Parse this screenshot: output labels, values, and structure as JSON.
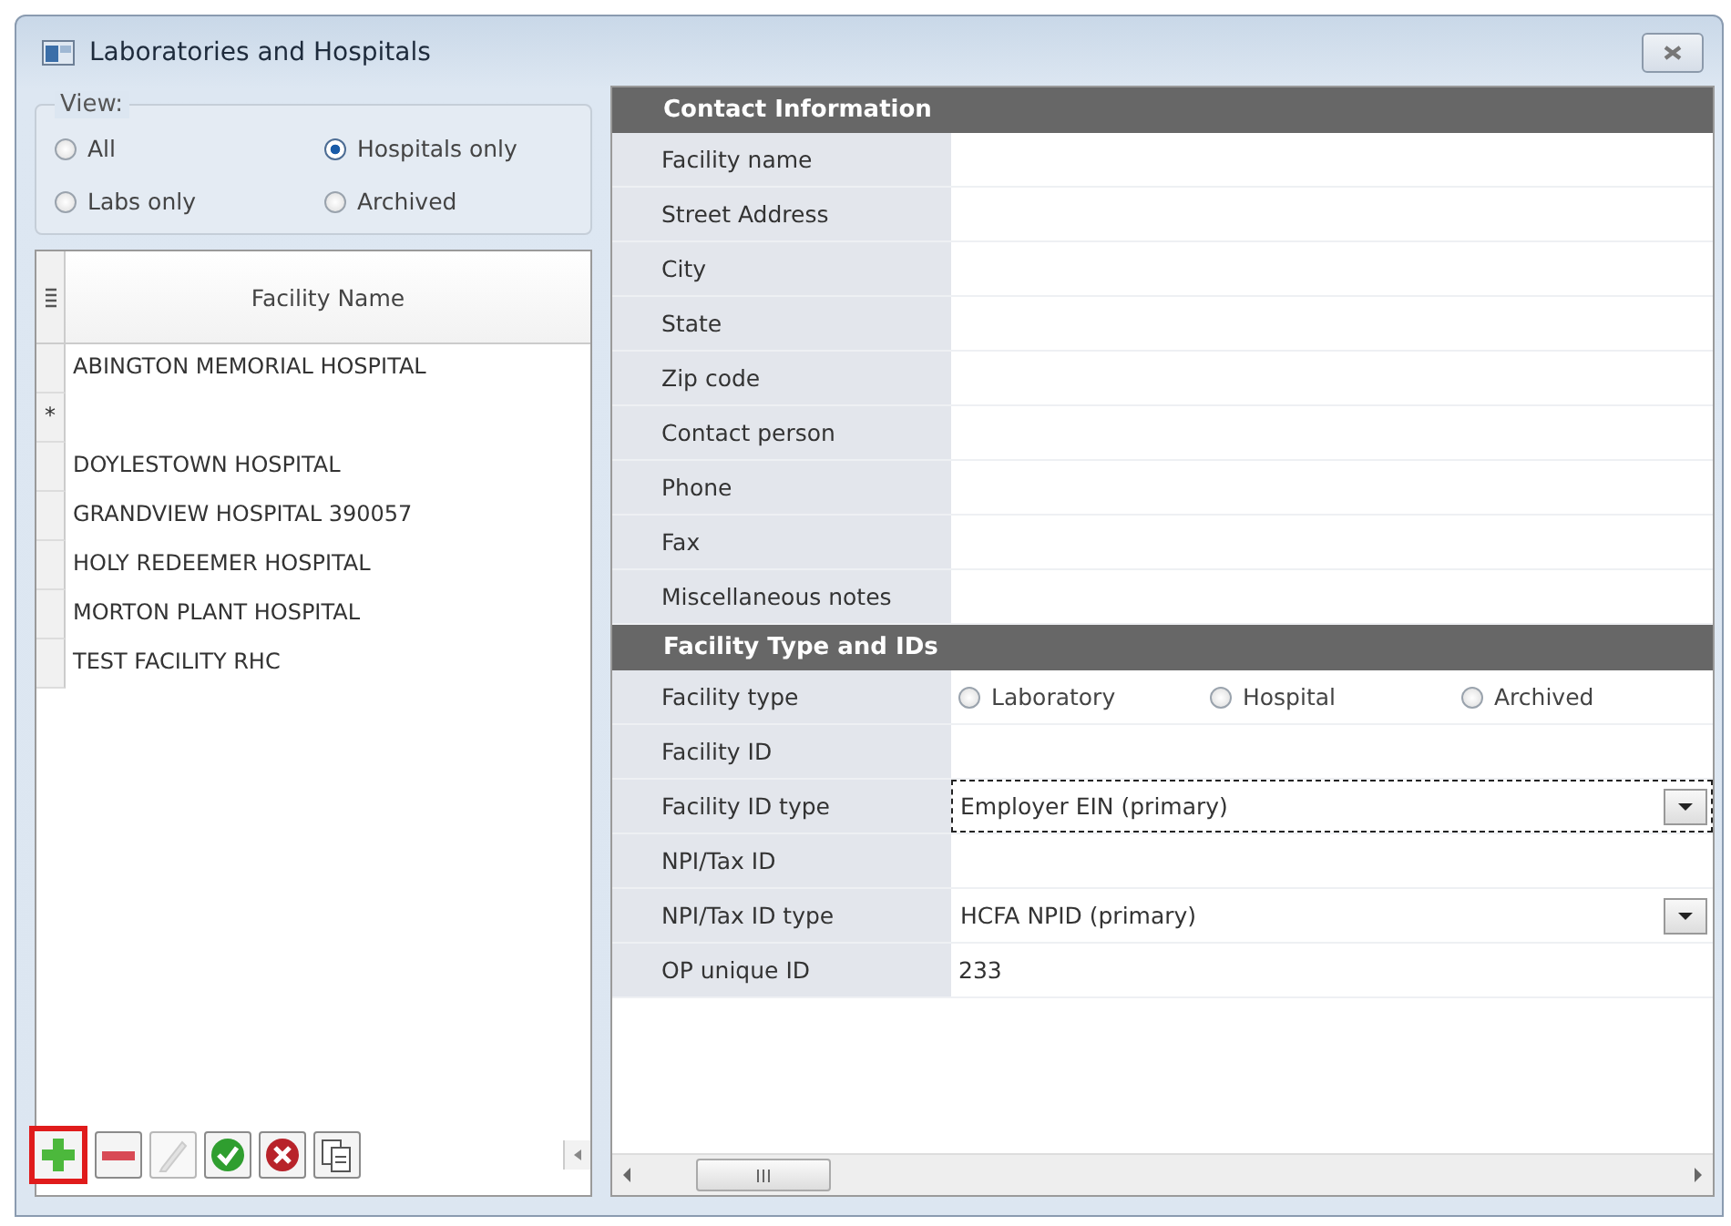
{
  "window": {
    "title": "Laboratories and Hospitals"
  },
  "view_filter": {
    "label": "View:",
    "options": [
      {
        "label": "All",
        "selected": false
      },
      {
        "label": "Hospitals only",
        "selected": true
      },
      {
        "label": "Labs only",
        "selected": false
      },
      {
        "label": "Archived",
        "selected": false
      }
    ]
  },
  "facility_list": {
    "column": "Facility Name",
    "rows": [
      {
        "kind": "record",
        "name": "ABINGTON MEMORIAL HOSPITAL"
      },
      {
        "kind": "new",
        "marker": "*"
      },
      {
        "kind": "record",
        "name": "DOYLESTOWN HOSPITAL"
      },
      {
        "kind": "record",
        "name": "GRANDVIEW HOSPITAL 390057"
      },
      {
        "kind": "record",
        "name": "HOLY REDEEMER HOSPITAL"
      },
      {
        "kind": "record",
        "name": "MORTON PLANT HOSPITAL"
      },
      {
        "kind": "record",
        "name": "TEST FACILITY RHC"
      }
    ]
  },
  "toolbar": [
    {
      "kind": "add",
      "highlighted": true,
      "disabled": false
    },
    {
      "kind": "remove",
      "highlighted": false,
      "disabled": false
    },
    {
      "kind": "edit",
      "highlighted": false,
      "disabled": true
    },
    {
      "kind": "accept",
      "highlighted": false,
      "disabled": false
    },
    {
      "kind": "cancel",
      "highlighted": false,
      "disabled": false
    },
    {
      "kind": "copy",
      "highlighted": false,
      "disabled": false
    }
  ],
  "sections": [
    {
      "title": "Contact Information",
      "fields": [
        {
          "kind": "text",
          "label": "Facility name"
        },
        {
          "kind": "text",
          "label": "Street Address"
        },
        {
          "kind": "text",
          "label": "City"
        },
        {
          "kind": "text",
          "label": "State"
        },
        {
          "kind": "text",
          "label": "Zip code"
        },
        {
          "kind": "text",
          "label": "Contact person"
        },
        {
          "kind": "text",
          "label": "Phone"
        },
        {
          "kind": "text",
          "label": "Fax"
        },
        {
          "kind": "text",
          "label": "Miscellaneous notes"
        }
      ]
    },
    {
      "title": "Facility Type and IDs",
      "fields": [
        {
          "kind": "radio",
          "label": "Facility type",
          "options": [
            {
              "label": "Laboratory",
              "selected": false
            },
            {
              "label": "Hospital",
              "selected": false
            },
            {
              "label": "Archived",
              "selected": false
            }
          ]
        },
        {
          "kind": "text",
          "label": "Facility ID"
        },
        {
          "kind": "dropdown",
          "label": "Facility ID type",
          "value": "Employer EIN (primary)",
          "focused": true
        },
        {
          "kind": "text",
          "label": "NPI/Tax ID"
        },
        {
          "kind": "dropdown",
          "label": "NPI/Tax ID type",
          "value": "HCFA NPID (primary)",
          "focused": false
        },
        {
          "kind": "text",
          "label": "OP unique ID",
          "value": "233"
        }
      ]
    }
  ]
}
